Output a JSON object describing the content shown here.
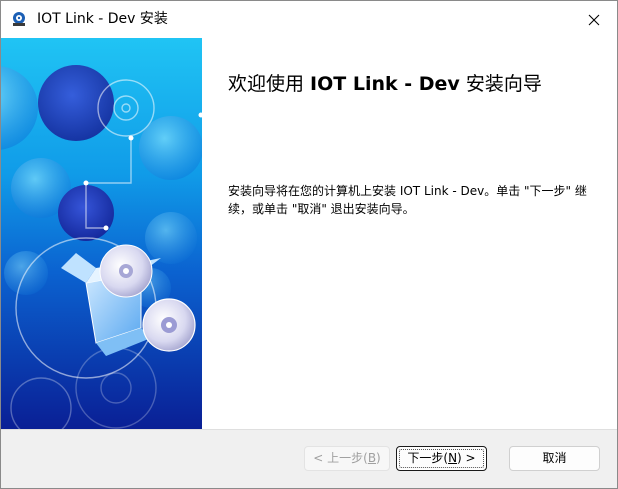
{
  "window": {
    "title": "IOT Link - Dev 安装"
  },
  "content": {
    "heading_prefix": "欢迎使用 ",
    "heading_product": "IOT Link - Dev",
    "heading_suffix": " 安装向导",
    "description": "安装向导将在您的计算机上安装 IOT Link - Dev。单击 \"下一步\" 继续，或单击 \"取消\" 退出安装向导。"
  },
  "buttons": {
    "back_label": "< 上一步(",
    "back_hotkey": "B",
    "back_close": ")",
    "next_label": "下一步(",
    "next_hotkey": "N",
    "next_close": ") >",
    "cancel_label": "取消"
  },
  "colors": {
    "banner_top": "#1fb6f0",
    "banner_mid": "#0a6fd8",
    "banner_bottom": "#0c2a9e",
    "bottom_bar": "#f0f0f0"
  },
  "icons": {
    "app": "installer-icon",
    "close": "close-icon",
    "banner_art": "software-box-cd-icon"
  }
}
